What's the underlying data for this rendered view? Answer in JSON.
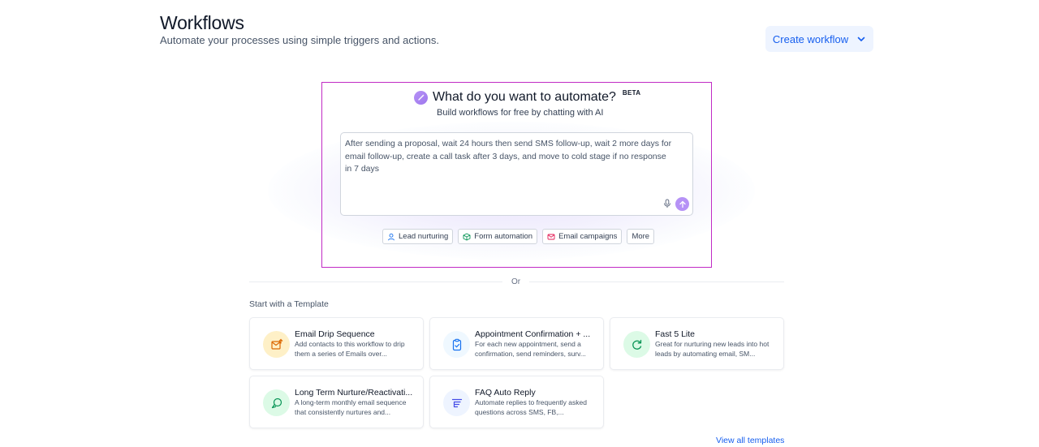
{
  "header": {
    "title": "Workflows",
    "subtitle": "Automate your processes using simple triggers and actions.",
    "create_label": "Create workflow"
  },
  "ai": {
    "question": "What do you want to automate?",
    "badge": "BETA",
    "subtitle": "Build workflows for free by chatting with AI",
    "prompt_text": "After sending a proposal, wait 24 hours then send SMS follow-up, wait 2 more days for email follow-up, create a call task after 3 days, and move to cold stage if no response in 7 days",
    "chips": [
      {
        "label": "Lead nurturing",
        "icon": "user-icon"
      },
      {
        "label": "Form automation",
        "icon": "box-icon"
      },
      {
        "label": "Email campaigns",
        "icon": "mail-icon"
      },
      {
        "label": "More"
      }
    ]
  },
  "divider_text": "Or",
  "templates": {
    "section_label": "Start with a Template",
    "cards": [
      {
        "title": "Email Drip Sequence",
        "desc": "Add contacts to this workflow to drip them a series of Emails over...",
        "icon": "email-upload-icon",
        "icon_bg": "#fef0c7",
        "icon_color": "#dc6803"
      },
      {
        "title": "Appointment Confirmation + ...",
        "desc": "For each new appointment, send a confirmation, send reminders, surv...",
        "icon": "clipboard-check-icon",
        "icon_bg": "#eff8ff",
        "icon_color": "#1570ef"
      },
      {
        "title": "Fast 5 Lite",
        "desc": "Great for nurturing new leads into hot leads by automating email, SM...",
        "icon": "refresh-icon",
        "icon_bg": "#dcfae6",
        "icon_color": "#079455"
      },
      {
        "title": "Long Term Nurture/Reactivati...",
        "desc": "A long-term monthly email sequence that consistently nurtures and...",
        "icon": "chat-bubbles-icon",
        "icon_bg": "#dcfae6",
        "icon_color": "#079455"
      },
      {
        "title": "FAQ Auto Reply",
        "desc": "Automate replies to frequently asked questions across SMS, FB,...",
        "icon": "text-align-icon",
        "icon_bg": "#eef4ff",
        "icon_color": "#444ce7"
      }
    ],
    "view_all_label": "View all templates"
  }
}
